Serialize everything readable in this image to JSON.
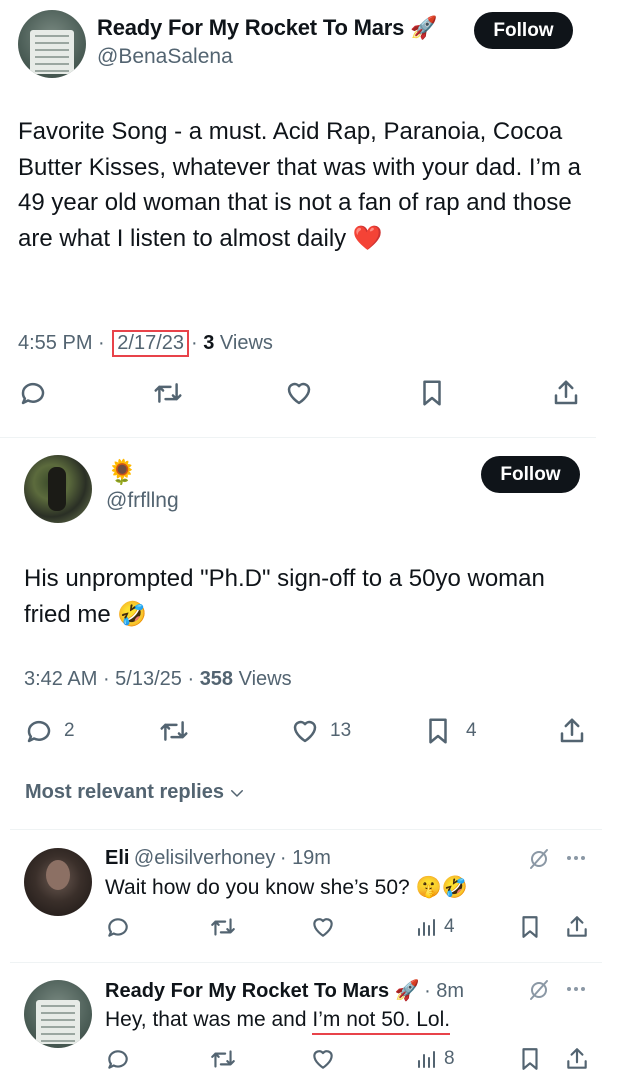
{
  "tweet": {
    "author_name": "Ready For My Rocket To Mars",
    "author_emoji": "🚀",
    "handle": "@BenaSalena",
    "follow_label": "Follow",
    "text": "Favorite Song - a must. Acid Rap, Paranoia, Cocoa Butter Kisses, whatever that was with your dad. I’m a 49 year old woman that is not a fan of rap and those are what I listen to almost daily ❤️",
    "time": "4:55 PM",
    "date": "2/17/23",
    "views_count": "3",
    "views_label": "Views"
  },
  "quote": {
    "author_emoji": "🌻",
    "handle": "@frfllng",
    "follow_label": "Follow",
    "text": "His unprompted \"Ph.D\" sign-off to a 50yo woman fried me 🤣",
    "time": "3:42 AM",
    "date": "5/13/25",
    "views_count": "358",
    "views_label": "Views",
    "reply_count": "2",
    "like_count": "13",
    "bookmark_count": "4"
  },
  "sort_label": "Most relevant replies",
  "replies": [
    {
      "name": "Eli",
      "handle": "@elisilverhoney",
      "age": "19m",
      "text": "Wait how do you know she’s 50? 🤫🤣",
      "views": "4"
    },
    {
      "name": "Ready For My Rocket To Mars 🚀",
      "handle": "",
      "age": "8m",
      "text_plain": "Hey, that was me and ",
      "text_underlined": "I’m not 50. Lol.",
      "views": "8"
    }
  ],
  "colors": {
    "text": "#0f1419",
    "muted": "#536471",
    "annotation_red": "#e8434a",
    "button_bg": "#0f1419"
  },
  "icons": [
    "reply-icon",
    "retweet-icon",
    "like-icon",
    "bookmark-icon",
    "share-icon",
    "grok-icon",
    "more-icon",
    "views-icon",
    "chevron-down-icon"
  ]
}
